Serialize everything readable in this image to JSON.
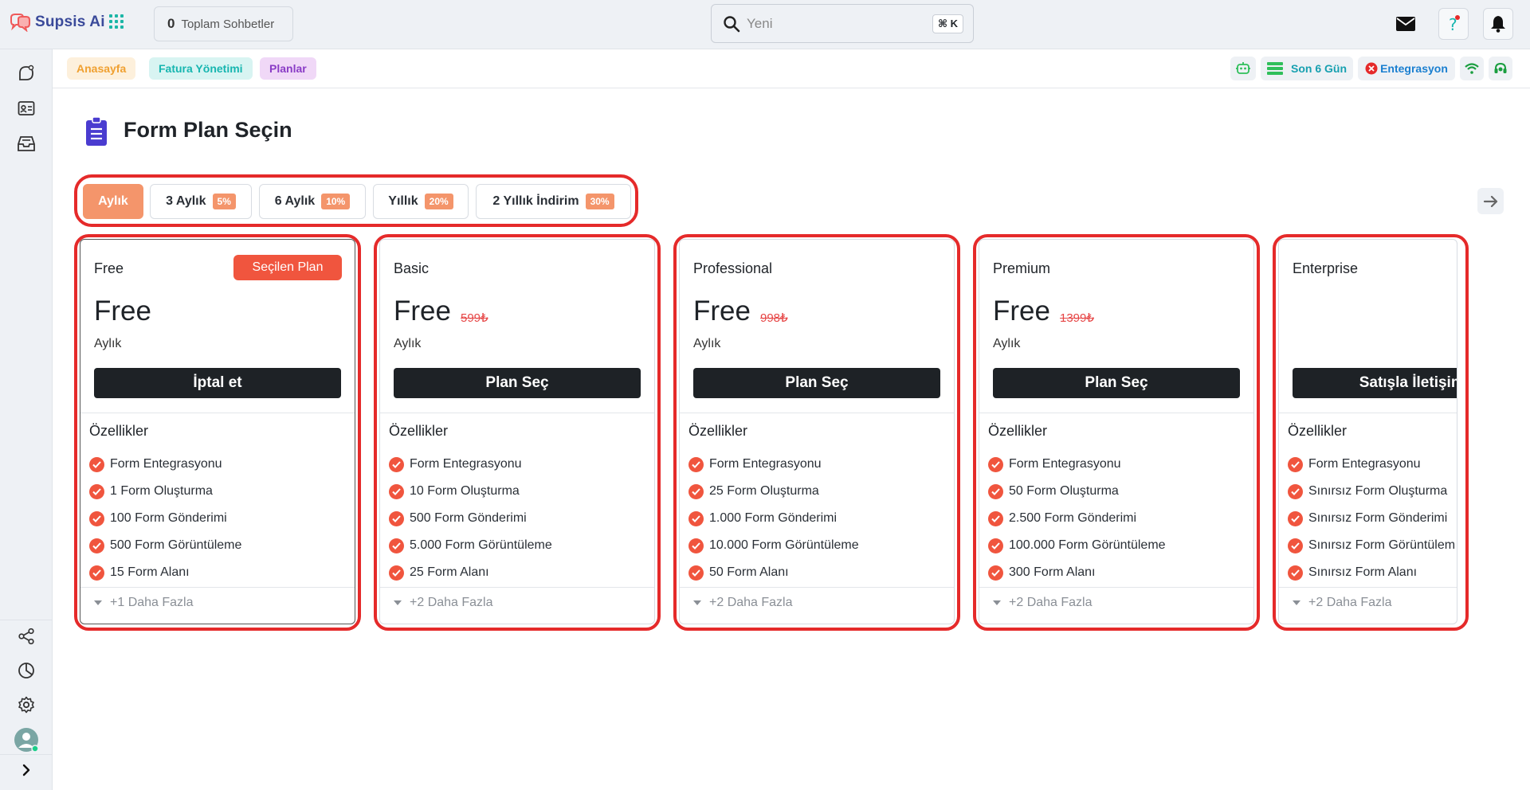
{
  "app": {
    "name": "Supsis Ai"
  },
  "header": {
    "total_count": "0",
    "total_label": "Toplam Sohbetler",
    "search_placeholder": "Yeni",
    "shortcut": "⌘ K"
  },
  "breadcrumbs": [
    {
      "label": "Anasayfa"
    },
    {
      "label": "Fatura Yönetimi"
    },
    {
      "label": "Planlar"
    }
  ],
  "status": {
    "days_label": "Son 6 Gün",
    "integration_label": "Entegrasyon"
  },
  "page": {
    "title": "Form Plan Seçin"
  },
  "period_tabs": [
    {
      "label": "Aylık",
      "discount": "",
      "active": true
    },
    {
      "label": "3 Aylık",
      "discount": "5%"
    },
    {
      "label": "6 Aylık",
      "discount": "10%"
    },
    {
      "label": "Yıllık",
      "discount": "20%"
    },
    {
      "label": "2 Yıllık İndirim",
      "discount": "30%"
    }
  ],
  "features_title": "Özellikler",
  "plans": [
    {
      "name": "Free",
      "price": "Free",
      "old_price": "",
      "period": "Aylık",
      "selected_label": "Seçilen Plan",
      "cta": "İptal et",
      "features": [
        "Form Entegrasyonu",
        "1 Form Oluşturma",
        "100 Form Gönderimi",
        "500 Form Görüntüleme",
        "15 Form Alanı"
      ],
      "more": "+1 Daha Fazla"
    },
    {
      "name": "Basic",
      "price": "Free",
      "old_price": "599₺",
      "period": "Aylık",
      "cta": "Plan Seç",
      "features": [
        "Form Entegrasyonu",
        "10 Form Oluşturma",
        "500 Form Gönderimi",
        "5.000 Form Görüntüleme",
        "25 Form Alanı"
      ],
      "more": "+2 Daha Fazla"
    },
    {
      "name": "Professional",
      "price": "Free",
      "old_price": "998₺",
      "period": "Aylık",
      "cta": "Plan Seç",
      "features": [
        "Form Entegrasyonu",
        "25 Form Oluşturma",
        "1.000 Form Gönderimi",
        "10.000 Form Görüntüleme",
        "50 Form Alanı"
      ],
      "more": "+2 Daha Fazla"
    },
    {
      "name": "Premium",
      "price": "Free",
      "old_price": "1399₺",
      "period": "Aylık",
      "cta": "Plan Seç",
      "features": [
        "Form Entegrasyonu",
        "50 Form Oluşturma",
        "2.500 Form Gönderimi",
        "100.000 Form Görüntüleme",
        "300 Form Alanı"
      ],
      "more": "+2 Daha Fazla"
    },
    {
      "name": "Enterprise",
      "price": "",
      "old_price": "",
      "period": "",
      "cta": "Satışla İletişime",
      "features": [
        "Form Entegrasyonu",
        "Sınırsız Form Oluşturma",
        "Sınırsız Form Gönderimi",
        "Sınırsız Form Görüntülem",
        "Sınırsız Form Alanı"
      ],
      "more": "+2 Daha Fazla"
    }
  ],
  "colors": {
    "accent": "#f4956b",
    "danger": "#e52a2a",
    "button_dark": "#1e2226",
    "brand": "#3a4a9a",
    "crumb_home": "#f0a030",
    "crumb_billing": "#17b6b0",
    "crumb_plans": "#8a3cc6"
  }
}
